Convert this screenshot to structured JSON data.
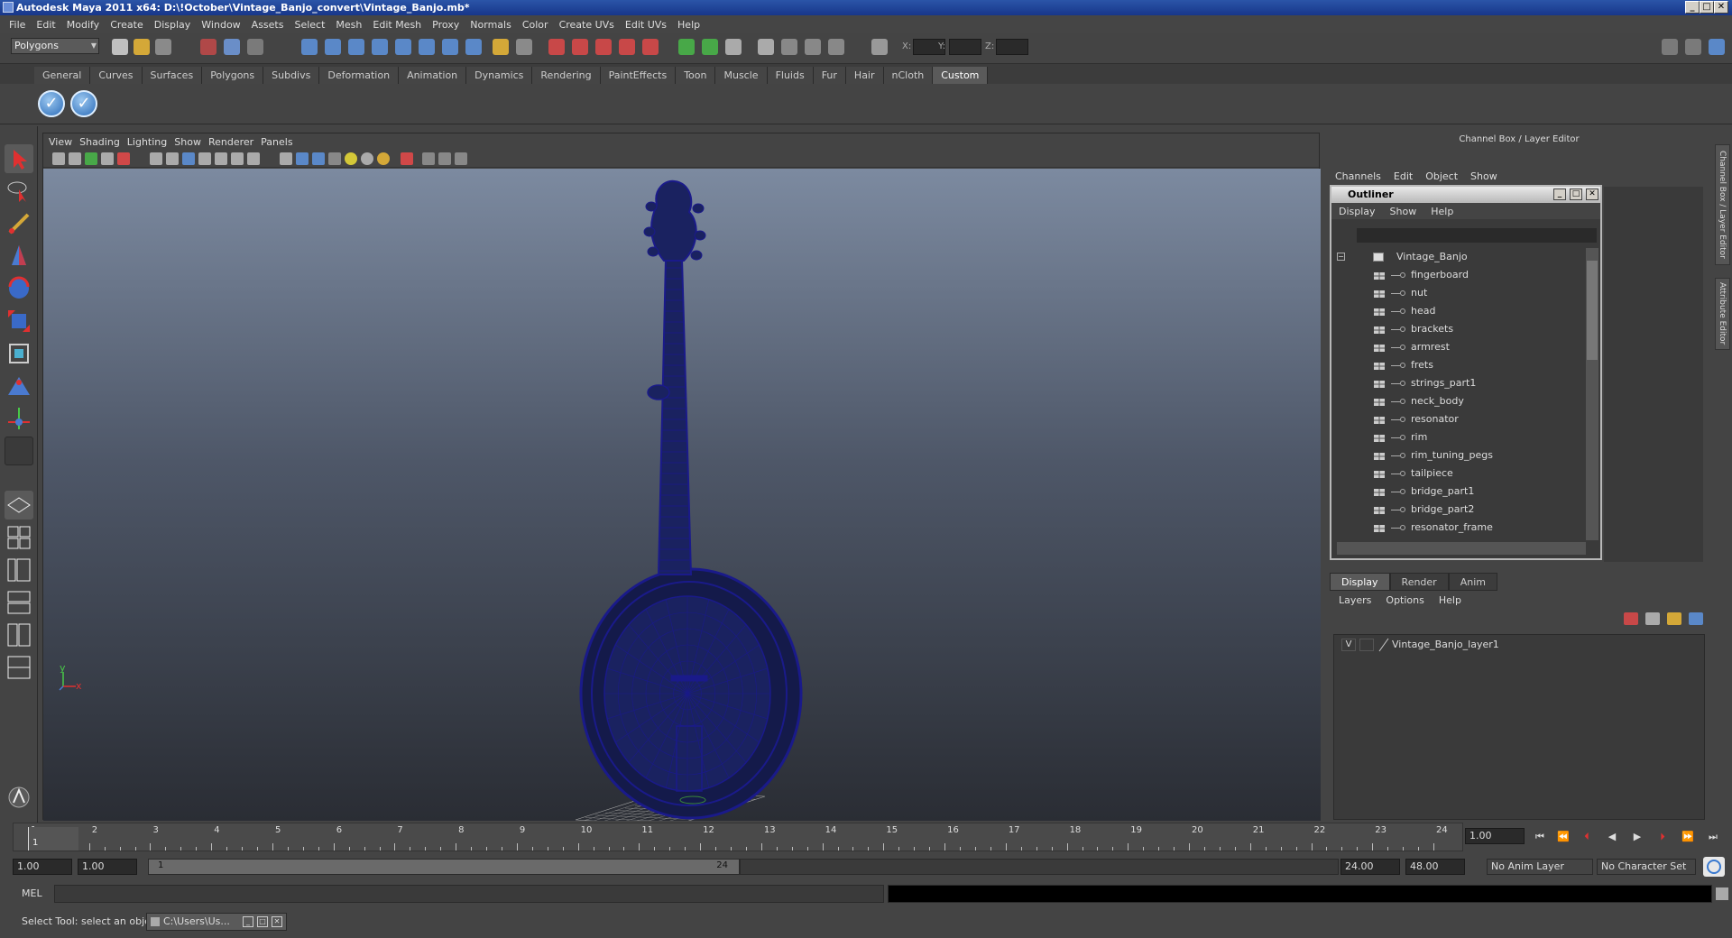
{
  "window": {
    "title": "Autodesk Maya 2011 x64: D:\\!October\\Vintage_Banjo_convert\\Vintage_Banjo.mb*",
    "controls": [
      "_",
      "□",
      "✕"
    ]
  },
  "menubar": [
    "File",
    "Edit",
    "Modify",
    "Create",
    "Display",
    "Window",
    "Assets",
    "Select",
    "Mesh",
    "Edit Mesh",
    "Proxy",
    "Normals",
    "Color",
    "Create UVs",
    "Edit UVs",
    "Help"
  ],
  "statusline": {
    "mode": "Polygons",
    "x_label": "X:",
    "y_label": "Y:",
    "z_label": "Z:"
  },
  "shelf_tabs": [
    "General",
    "Curves",
    "Surfaces",
    "Polygons",
    "Subdivs",
    "Deformation",
    "Animation",
    "Dynamics",
    "Rendering",
    "PaintEffects",
    "Toon",
    "Muscle",
    "Fluids",
    "Fur",
    "Hair",
    "nCloth",
    "Custom"
  ],
  "shelf_active": "Custom",
  "shelf_buttons": [
    "check-icon",
    "check-icon"
  ],
  "viewport": {
    "menu": [
      "View",
      "Shading",
      "Lighting",
      "Show",
      "Renderer",
      "Panels"
    ],
    "axis_y": "y",
    "axis_x": "x",
    "wire_color": "#1a1a8a"
  },
  "channel_box": {
    "header": "Channel Box / Layer Editor",
    "menu": [
      "Channels",
      "Edit",
      "Object",
      "Show"
    ]
  },
  "outliner": {
    "title": "Outliner",
    "menu": [
      "Display",
      "Show",
      "Help"
    ],
    "root": "Vintage_Banjo",
    "items": [
      "fingerboard",
      "nut",
      "head",
      "brackets",
      "armrest",
      "frets",
      "strings_part1",
      "neck_body",
      "resonator",
      "rim",
      "rim_tuning_pegs",
      "tailpiece",
      "bridge_part1",
      "bridge_part2",
      "resonator_frame"
    ]
  },
  "layer_editor": {
    "tabs": [
      "Display",
      "Render",
      "Anim"
    ],
    "active_tab": "Display",
    "menu": [
      "Layers",
      "Options",
      "Help"
    ],
    "layer_visibility": "V",
    "layer_name": "Vintage_Banjo_layer1"
  },
  "side_tabs": [
    "Channel Box / Layer Editor",
    "Attribute Editor"
  ],
  "timeline": {
    "ticks": [
      "1",
      "2",
      "3",
      "4",
      "5",
      "6",
      "7",
      "8",
      "9",
      "10",
      "11",
      "12",
      "13",
      "14",
      "15",
      "16",
      "17",
      "18",
      "19",
      "20",
      "21",
      "22",
      "23",
      "24"
    ],
    "current_frame_marker": "1",
    "current_time": "1.00"
  },
  "range": {
    "start": "1.00",
    "playback_start": "1.00",
    "slider_start": "1",
    "slider_end": "24",
    "playback_end": "24.00",
    "end": "48.00",
    "anim_layer": "No Anim Layer",
    "character_set": "No Character Set"
  },
  "command_line": {
    "label": "MEL"
  },
  "help_line": {
    "text": "Select Tool: select an object",
    "taskbar_item": "C:\\Users\\Us..."
  }
}
